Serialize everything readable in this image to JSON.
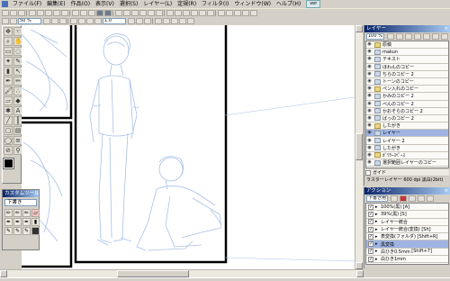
{
  "menu": {
    "items": [
      "ファイル(F)",
      "編集(E)",
      "作品(O)",
      "表示(V)",
      "選択(S)",
      "レイヤー(L)",
      "定規(R)",
      "フィルタ(I)",
      "ウィンドウ(W)",
      "ヘルプ(H)"
    ],
    "version_badge": "ver"
  },
  "toolbar": {
    "zoom_value": "50 %",
    "brush_size": "1.0"
  },
  "layer_panel": {
    "title": "レイヤー",
    "mode_value": "100 %",
    "layers": [
      {
        "name": "原稿",
        "folder": true
      },
      {
        "name": "makun",
        "folder": false
      },
      {
        "name": "テキスト",
        "folder": false
      },
      {
        "name": "ほわんのコピー",
        "folder": false
      },
      {
        "name": "ちらのコピー 2",
        "folder": false
      },
      {
        "name": "トーンのコピー",
        "folder": false
      },
      {
        "name": "ペン入れのコピー",
        "folder": true
      },
      {
        "name": "かみのコピー 2",
        "folder": false
      },
      {
        "name": "ぺんのコピー 2",
        "folder": false
      },
      {
        "name": "かおそらのコピー 2",
        "folder": false
      },
      {
        "name": "ばっのコピー 2",
        "folder": false
      },
      {
        "name": "したがき",
        "folder": true
      },
      {
        "name": "レイヤー",
        "folder": false,
        "active": true
      },
      {
        "name": "レイヤー 2",
        "folder": false
      },
      {
        "name": "したがき",
        "folder": false
      },
      {
        "name": "ｶﾞﾜｸｰｽﾍﾟｰｽ",
        "folder": true
      },
      {
        "name": "選択範囲レイヤーのコピー",
        "folder": false
      }
    ],
    "guide_label": "ガイド",
    "status": "ラスターレイヤー 600 dpi 黒白(2bit)"
  },
  "action_panel": {
    "title": "アクション",
    "set_value": "下書き用",
    "actions": [
      {
        "name": "100%(黒)",
        "shortcut": "[A]"
      },
      {
        "name": "39%(黒)",
        "shortcut": "[S]"
      },
      {
        "name": "レイヤー統合",
        "shortcut": ""
      },
      {
        "name": "レイヤー統合(変換)",
        "shortcut": "[Sh]"
      },
      {
        "name": "表変換(フォルダ)",
        "shortcut": "[Shift+R]"
      },
      {
        "name": "黒変換",
        "shortcut": "",
        "active": true
      },
      {
        "name": "白ひき0.5mm",
        "shortcut": "[Shift+7]"
      },
      {
        "name": "白ひき1mm",
        "shortcut": ""
      }
    ]
  },
  "custom_tools": {
    "title": "カスタムツール",
    "set_value": "下書き"
  },
  "colors": {
    "canvas_bg": "#ffffff",
    "title_bar": "#0a246a",
    "sketch_line": "#a9c1e6",
    "panel_bg": "#d4d0c8",
    "layer_active": "#9fb4e3"
  }
}
